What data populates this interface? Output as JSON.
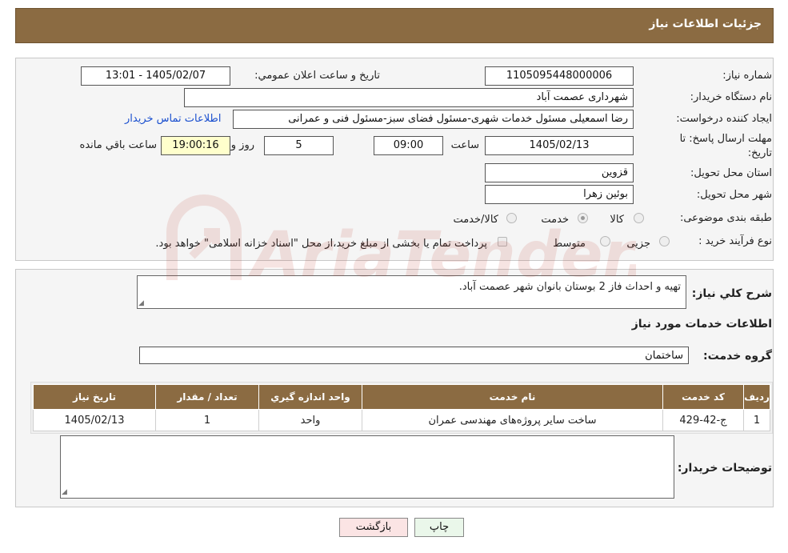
{
  "header": {
    "title": "جزئیات اطلاعات نیاز"
  },
  "form": {
    "need_number_label": "شماره نیاز:",
    "need_number": "1105095448000006",
    "announce_label": "تاریخ و ساعت اعلان عمومي:",
    "announce_value": "1405/02/07 - 13:01",
    "buyer_org_label": "نام دستگاه خريدار:",
    "buyer_org": "شهرداری عصمت آباد",
    "creator_label": "ایجاد کننده درخواست:",
    "creator": "رضا اسمعیلی مسئول خدمات شهری-مسئول فضای سبز-مسئول فنی و عمرانی",
    "contact_link": "اطلاعات تماس خريدار",
    "deadline_label_1": "مهلت ارسال پاسخ: تا",
    "deadline_label_2": "تاریخ:",
    "deadline_date": "1405/02/13",
    "time_label": "ساعت",
    "deadline_time": "09:00",
    "days_value": "5",
    "days_label": "روز و",
    "remaining_time": "19:00:16",
    "remaining_label": "ساعت باقي مانده",
    "province_label": "استان محل تحويل:",
    "province": "قزوین",
    "city_label": "شهر محل تحويل:",
    "city": "بوئین زهرا",
    "category_label": "طبقه بندی موضوعی:",
    "category_options": [
      "کالا",
      "خدمت",
      "کالا/خدمت"
    ],
    "category_selected": "خدمت",
    "process_label": "نوع فرآیند خرید :",
    "process_options": [
      "جزیی",
      "متوسط"
    ],
    "payment_note": "پرداخت تمام یا بخشی از مبلغ خرید،از محل \"اسناد خزانه اسلامی\" خواهد بود."
  },
  "details": {
    "summary_label": "شرح کلي نياز:",
    "summary": "تهیه و احداث فاز 2 بوستان بانوان شهر عصمت آباد.",
    "services_title": "اطلاعات خدمات مورد نياز",
    "service_group_label": "گروه خدمت:",
    "service_group": "ساختمان",
    "table": {
      "headers": [
        "رديف",
        "کد خدمت",
        "نام خدمت",
        "واحد اندازه گيري",
        "تعداد / مقدار",
        "تاريخ نياز"
      ],
      "rows": [
        [
          "1",
          "ج-42-429",
          "ساخت سایر پروژه‌های مهندسی عمران",
          "واحد",
          "1",
          "1405/02/13"
        ]
      ]
    },
    "buyer_notes_label": "توضيحات خريدار:"
  },
  "buttons": {
    "print": "چاپ",
    "back": "بازگشت"
  },
  "watermark": {
    "text": "AriaTender.neT",
    "color": "#c0392b"
  },
  "colors": {
    "header_bg": "#8b6b42",
    "link": "#1a4fcf",
    "highlight": "#ffffcc"
  }
}
